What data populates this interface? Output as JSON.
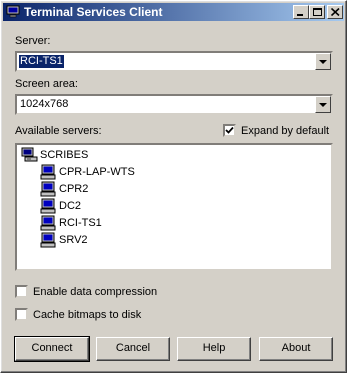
{
  "window": {
    "title": "Terminal Services Client"
  },
  "server": {
    "label": "Server:",
    "value": "RCI-TS1"
  },
  "screen_area": {
    "label": "Screen area:",
    "value": "1024x768"
  },
  "available": {
    "label": "Available servers:",
    "expand_label": "Expand by default",
    "expand_checked": true,
    "root": "SCRIBES",
    "servers": [
      "CPR-LAP-WTS",
      "CPR2",
      "DC2",
      "RCI-TS1",
      "SRV2"
    ]
  },
  "options": {
    "compression_label": "Enable data compression",
    "compression_checked": false,
    "cache_label": "Cache bitmaps to disk",
    "cache_checked": false
  },
  "buttons": {
    "connect": "Connect",
    "cancel": "Cancel",
    "help": "Help",
    "about": "About"
  },
  "colors": {
    "title_start": "#0a246a",
    "title_end": "#a6caf0",
    "dialog_face": "#d4d0c8",
    "selection": "#0a246a"
  }
}
